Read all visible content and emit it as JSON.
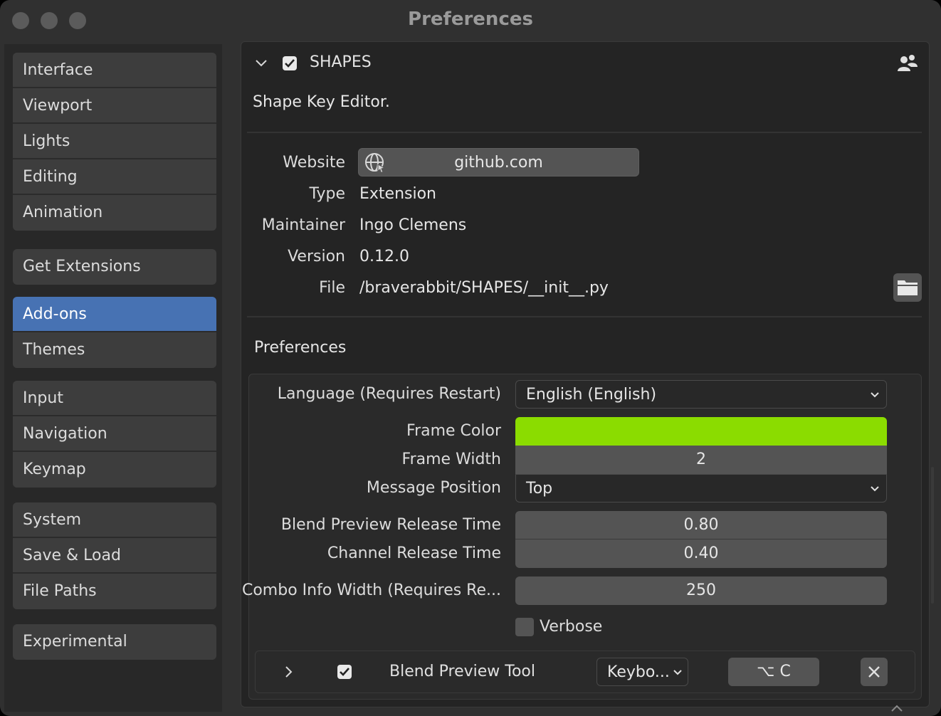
{
  "window": {
    "title": "Preferences"
  },
  "sidebar": {
    "groups": [
      [
        "Interface",
        "Viewport",
        "Lights",
        "Editing",
        "Animation"
      ],
      [
        "Get Extensions"
      ],
      [
        "Add-ons",
        "Themes"
      ],
      [
        "Input",
        "Navigation",
        "Keymap"
      ],
      [
        "System",
        "Save & Load",
        "File Paths"
      ],
      [
        "Experimental"
      ]
    ],
    "active": "Add-ons"
  },
  "addon": {
    "name": "SHAPES",
    "enabled": true,
    "description": "Shape Key Editor.",
    "info": {
      "website_label": "Website",
      "website": "github.com",
      "type_label": "Type",
      "type": "Extension",
      "maintainer_label": "Maintainer",
      "maintainer": "Ingo Clemens",
      "version_label": "Version",
      "version": "0.12.0",
      "file_label": "File",
      "file": "/braverabbit/SHAPES/__init__.py"
    }
  },
  "preferences": {
    "title": "Preferences",
    "language_label": "Language (Requires Restart)",
    "language_value": "English (English)",
    "frame_color_label": "Frame Color",
    "frame_color": "#8bdc00",
    "frame_width_label": "Frame Width",
    "frame_width": "2",
    "message_position_label": "Message Position",
    "message_position": "Top",
    "blend_preview_label": "Blend Preview Release Time",
    "blend_preview": "0.80",
    "channel_release_label": "Channel Release Time",
    "channel_release": "0.40",
    "combo_info_label": "Combo Info Width (Requires Re...",
    "combo_info": "250",
    "verbose_label": "Verbose",
    "verbose": false
  },
  "keymap_item": {
    "label": "Blend Preview Tool",
    "enabled": true,
    "type": "Keybo...",
    "shortcut": "⌥ C"
  },
  "colors": {
    "accent": "#4772b3",
    "frame_color": "#8bdc00"
  }
}
